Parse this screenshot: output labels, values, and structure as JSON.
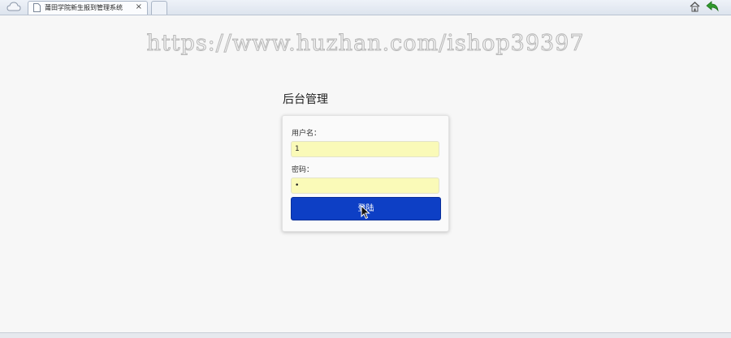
{
  "browser": {
    "tab_title": "莆田学院新生报到管理系统",
    "tab_close": "×",
    "icons": [
      "cloud-icon",
      "page-icon",
      "home-icon",
      "back-icon"
    ]
  },
  "watermark": "https://www.huzhan.com/ishop39397",
  "login": {
    "panel_title": "后台管理",
    "username_label": "用户名：",
    "username_value": "1",
    "password_label": "密码：",
    "password_value": "•",
    "submit_label": "登陆"
  },
  "colors": {
    "button": "#0d3fc5",
    "input_fill": "#fafab8",
    "background": "#f7f7f7"
  }
}
